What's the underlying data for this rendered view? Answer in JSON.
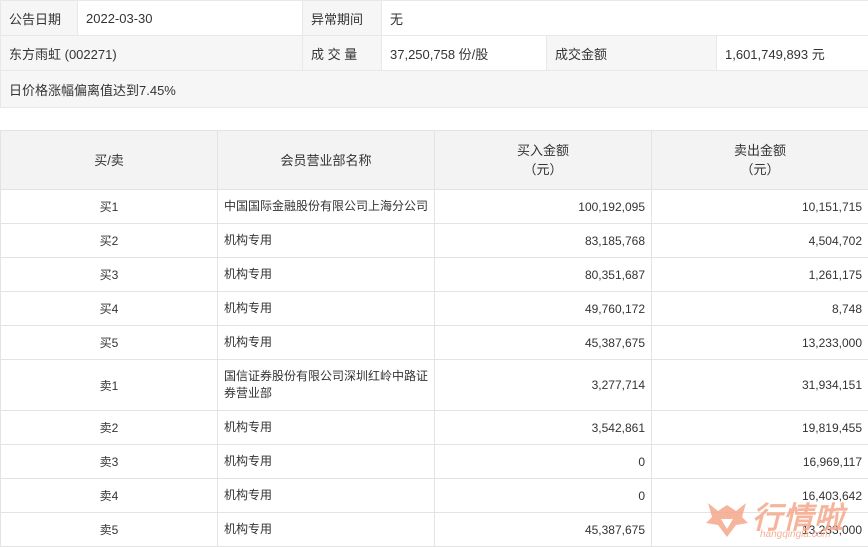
{
  "summary": {
    "announce_date_label": "公告日期",
    "announce_date_value": "2022-03-30",
    "abnormal_period_label": "异常期间",
    "abnormal_period_value": "无",
    "stock": "东方雨虹 (002271)",
    "volume_label": "成 交 量",
    "volume_value": "37,250,758 份/股",
    "amount_label": "成交金额",
    "amount_value": "1,601,749,893 元",
    "note": "日价格涨幅偏离值达到7.45%"
  },
  "table": {
    "headers": {
      "side": "买/卖",
      "dept": "会员营业部名称",
      "buy_line1": "买入金额",
      "buy_line2": "（元）",
      "sell_line1": "卖出金额",
      "sell_line2": "（元）"
    },
    "rows": [
      {
        "side": "买1",
        "dept": "中国国际金融股份有限公司上海分公司",
        "buy": "100,192,095",
        "sell": "10,151,715"
      },
      {
        "side": "买2",
        "dept": "机构专用",
        "buy": "83,185,768",
        "sell": "4,504,702"
      },
      {
        "side": "买3",
        "dept": "机构专用",
        "buy": "80,351,687",
        "sell": "1,261,175"
      },
      {
        "side": "买4",
        "dept": "机构专用",
        "buy": "49,760,172",
        "sell": "8,748"
      },
      {
        "side": "买5",
        "dept": "机构专用",
        "buy": "45,387,675",
        "sell": "13,233,000"
      },
      {
        "side": "卖1",
        "dept": "国信证券股份有限公司深圳红岭中路证券营业部",
        "buy": "3,277,714",
        "sell": "31,934,151"
      },
      {
        "side": "卖2",
        "dept": "机构专用",
        "buy": "3,542,861",
        "sell": "19,819,455"
      },
      {
        "side": "卖3",
        "dept": "机构专用",
        "buy": "0",
        "sell": "16,969,117"
      },
      {
        "side": "卖4",
        "dept": "机构专用",
        "buy": "0",
        "sell": "16,403,642"
      },
      {
        "side": "卖5",
        "dept": "机构专用",
        "buy": "45,387,675",
        "sell": "13,233,000"
      }
    ]
  },
  "watermark": {
    "text": "行情啦",
    "url": "hangqingla.com",
    "color": "#f4a88a",
    "icon": "bull-logo-icon"
  }
}
